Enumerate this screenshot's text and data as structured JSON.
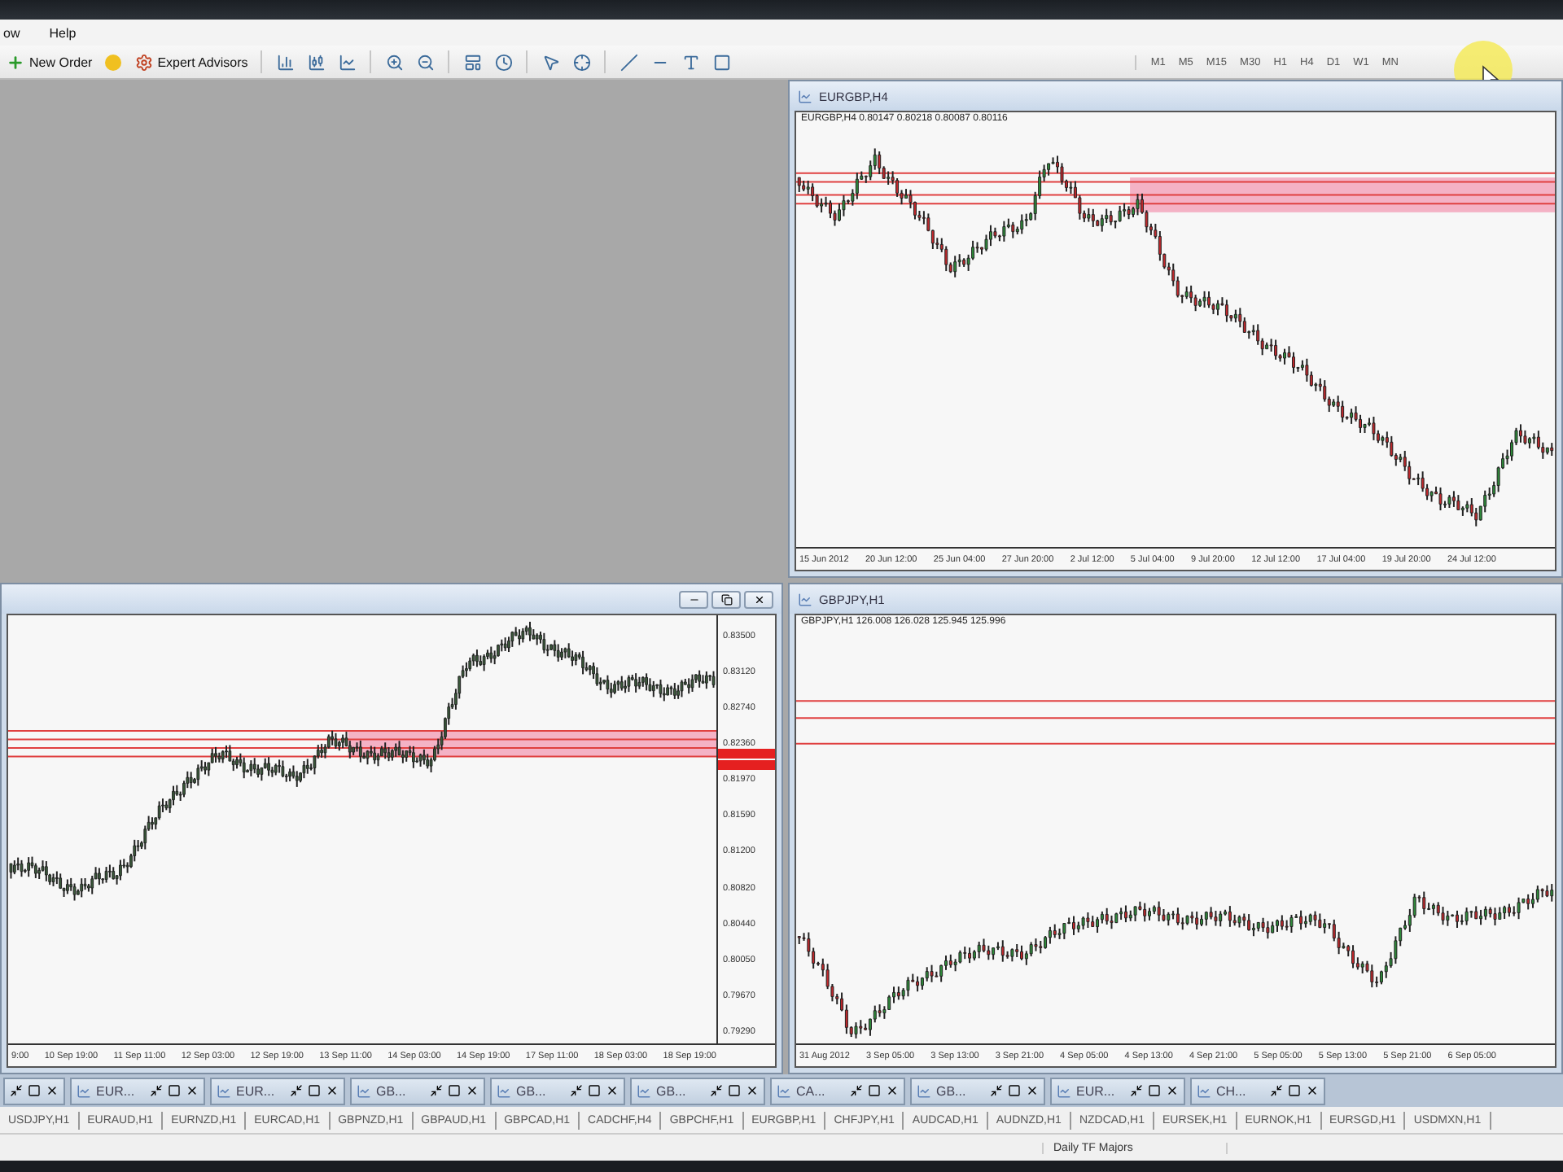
{
  "menu_bar": {
    "items": [
      "ow",
      "Help"
    ]
  },
  "toolbar": {
    "new_order": "New Order",
    "expert_advisors": "Expert Advisors",
    "timeframes": [
      "M1",
      "M5",
      "M15",
      "M30",
      "H1",
      "H4",
      "D1",
      "W1",
      "MN"
    ]
  },
  "charts": [
    {
      "kind": "empty"
    },
    {
      "kind": "chart",
      "title": "EURGBP,H4",
      "header": "EURGBP,H4  0.80147 0.80218 0.80087 0.80116",
      "time_labels": [
        "15 Jun 2012",
        "20 Jun 12:00",
        "25 Jun 04:00",
        "27 Jun 20:00",
        "2 Jul 12:00",
        "5 Jul 04:00",
        "9 Jul 20:00",
        "12 Jul 12:00",
        "17 Jul 04:00",
        "19 Jul 20:00",
        "24 Jul 12:00"
      ]
    },
    {
      "kind": "chart",
      "price_labels": [
        "0.83500",
        "0.83120",
        "0.82740",
        "0.82360",
        "0.81970",
        "0.81590",
        "0.81200",
        "0.80820",
        "0.80440",
        "0.80050",
        "0.79670",
        "0.79290"
      ],
      "time_labels": [
        "9:00",
        "10 Sep 19:00",
        "11 Sep 11:00",
        "12 Sep 03:00",
        "12 Sep 19:00",
        "13 Sep 11:00",
        "14 Sep 03:00",
        "14 Sep 19:00",
        "17 Sep 11:00",
        "18 Sep 03:00",
        "18 Sep 19:00"
      ]
    },
    {
      "kind": "chart",
      "title": "GBPJPY,H1",
      "header": "GBPJPY,H1  126.008 126.028 125.945 125.996",
      "time_labels": [
        "31 Aug 2012",
        "3 Sep 05:00",
        "3 Sep 13:00",
        "3 Sep 21:00",
        "4 Sep 05:00",
        "4 Sep 13:00",
        "4 Sep 21:00",
        "5 Sep 05:00",
        "5 Sep 13:00",
        "5 Sep 21:00",
        "6 Sep 05:00"
      ]
    }
  ],
  "minimized_windows": [
    "EUR...",
    "EUR...",
    "GB...",
    "GB...",
    "GB...",
    "CA...",
    "GB...",
    "EUR...",
    "CH..."
  ],
  "symbol_tabs": [
    "USDJPY,H1",
    "EURAUD,H1",
    "EURNZD,H1",
    "EURCAD,H1",
    "GBPNZD,H1",
    "GBPAUD,H1",
    "GBPCAD,H1",
    "CADCHF,H4",
    "GBPCHF,H1",
    "EURGBP,H1",
    "CHFJPY,H1",
    "AUDCAD,H1",
    "AUDNZD,H1",
    "NZDCAD,H1",
    "EURSEK,H1",
    "EURNOK,H1",
    "EURSGD,H1",
    "USDMXN,H1"
  ],
  "status_bar": {
    "profile": "Daily TF Majors"
  }
}
